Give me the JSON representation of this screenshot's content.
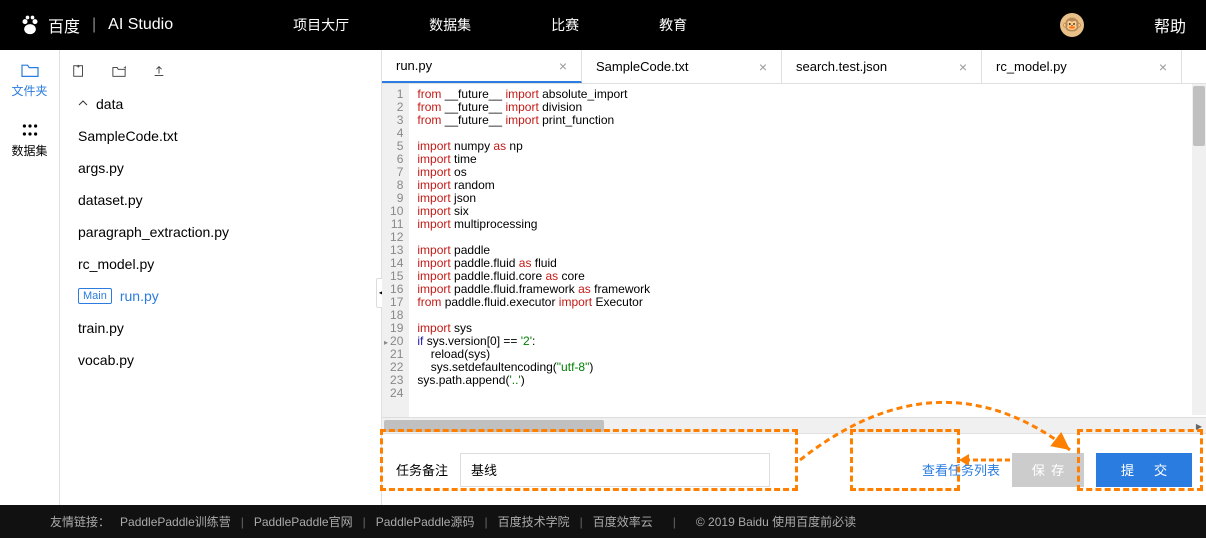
{
  "header": {
    "logo_text": "百度",
    "studio": "AI Studio",
    "nav": [
      "项目大厅",
      "数据集",
      "比赛",
      "教育"
    ],
    "help": "帮助"
  },
  "rail": {
    "files": "文件夹",
    "datasets": "数据集"
  },
  "tree": {
    "folder": "data",
    "files": [
      "SampleCode.txt",
      "args.py",
      "dataset.py",
      "paragraph_extraction.py",
      "rc_model.py"
    ],
    "main_badge": "Main",
    "main_file": "run.py",
    "files2": [
      "train.py",
      "vocab.py"
    ]
  },
  "tabs": [
    {
      "label": "run.py",
      "active": true
    },
    {
      "label": "SampleCode.txt",
      "active": false
    },
    {
      "label": "search.test.json",
      "active": false
    },
    {
      "label": "rc_model.py",
      "active": false
    }
  ],
  "code": [
    [
      [
        "kw",
        "from"
      ],
      [
        "id",
        " __future__ "
      ],
      [
        "kw",
        "import"
      ],
      [
        "id",
        " absolute_import"
      ]
    ],
    [
      [
        "kw",
        "from"
      ],
      [
        "id",
        " __future__ "
      ],
      [
        "kw",
        "import"
      ],
      [
        "id",
        " division"
      ]
    ],
    [
      [
        "kw",
        "from"
      ],
      [
        "id",
        " __future__ "
      ],
      [
        "kw",
        "import"
      ],
      [
        "id",
        " print_function"
      ]
    ],
    [],
    [
      [
        "kw",
        "import"
      ],
      [
        "id",
        " numpy "
      ],
      [
        "kw",
        "as"
      ],
      [
        "id",
        " np"
      ]
    ],
    [
      [
        "kw",
        "import"
      ],
      [
        "id",
        " time"
      ]
    ],
    [
      [
        "kw",
        "import"
      ],
      [
        "id",
        " os"
      ]
    ],
    [
      [
        "kw",
        "import"
      ],
      [
        "id",
        " random"
      ]
    ],
    [
      [
        "kw",
        "import"
      ],
      [
        "id",
        " json"
      ]
    ],
    [
      [
        "kw",
        "import"
      ],
      [
        "id",
        " six"
      ]
    ],
    [
      [
        "kw",
        "import"
      ],
      [
        "id",
        " multiprocessing"
      ]
    ],
    [],
    [
      [
        "kw",
        "import"
      ],
      [
        "id",
        " paddle"
      ]
    ],
    [
      [
        "kw",
        "import"
      ],
      [
        "id",
        " paddle.fluid "
      ],
      [
        "kw",
        "as"
      ],
      [
        "id",
        " fluid"
      ]
    ],
    [
      [
        "kw",
        "import"
      ],
      [
        "id",
        " paddle.fluid.core "
      ],
      [
        "kw",
        "as"
      ],
      [
        "id",
        " core"
      ]
    ],
    [
      [
        "kw",
        "import"
      ],
      [
        "id",
        " paddle.fluid.framework "
      ],
      [
        "kw",
        "as"
      ],
      [
        "id",
        " framework"
      ]
    ],
    [
      [
        "kw",
        "from"
      ],
      [
        "id",
        " paddle.fluid.executor "
      ],
      [
        "kw",
        "import"
      ],
      [
        "id",
        " Executor"
      ]
    ],
    [],
    [
      [
        "kw",
        "import"
      ],
      [
        "id",
        " sys"
      ]
    ],
    [
      [
        "kw2",
        "if"
      ],
      [
        "id",
        " sys.version[0] == "
      ],
      [
        "str",
        "'2'"
      ],
      [
        "id",
        ":"
      ]
    ],
    [
      [
        "id",
        "    reload(sys)"
      ]
    ],
    [
      [
        "id",
        "    sys.setdefaultencoding("
      ],
      [
        "str",
        "\"utf-8\""
      ],
      [
        "id",
        ")"
      ]
    ],
    [
      [
        "id",
        "sys.path.append("
      ],
      [
        "str",
        "'..'"
      ],
      [
        "id",
        ")"
      ]
    ],
    []
  ],
  "bottom": {
    "note_label": "任务备注",
    "note_value": "基线",
    "view_tasks": "查看任务列表",
    "save": "保存",
    "submit": "提 交"
  },
  "footer": {
    "label": "友情链接：",
    "links": [
      "PaddlePaddle训练营",
      "PaddlePaddle官网",
      "PaddlePaddle源码",
      "百度技术学院",
      "百度效率云"
    ],
    "copyright": "© 2019 Baidu 使用百度前必读"
  }
}
